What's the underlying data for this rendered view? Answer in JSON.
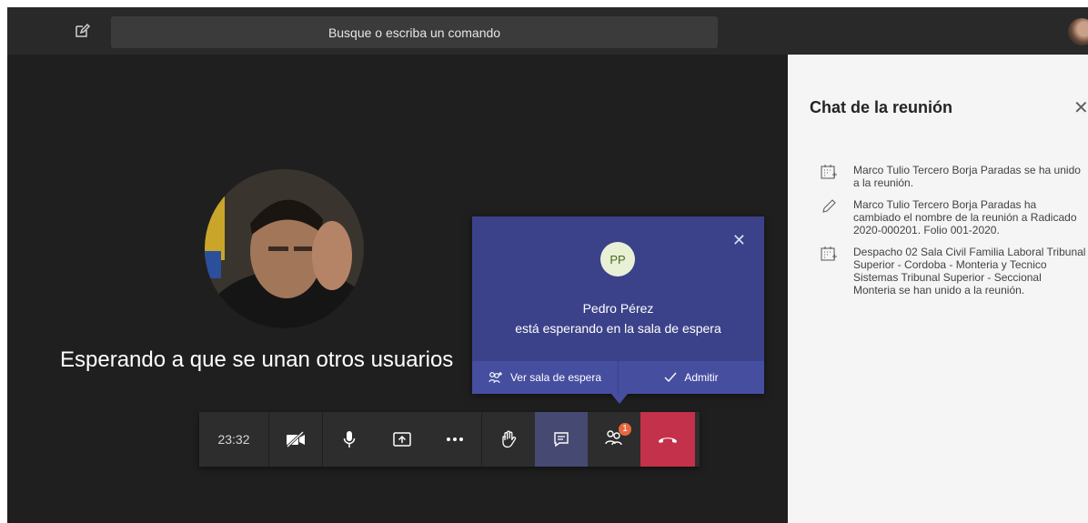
{
  "search": {
    "placeholder": "Busque o escriba un comando"
  },
  "stage": {
    "waiting_text": "Esperando a que se unan otros usuarios"
  },
  "lobby": {
    "initials": "PP",
    "name": "Pedro Pérez",
    "message": "está esperando en la sala de espera",
    "view_lobby_label": "Ver sala de espera",
    "admit_label": "Admitir"
  },
  "callbar": {
    "timer": "23:32",
    "participants_badge": "1"
  },
  "chat": {
    "title": "Chat de la reunión",
    "events": [
      {
        "icon": "join-icon",
        "text": "Marco Tulio Tercero Borja Paradas se ha unido a la reunión."
      },
      {
        "icon": "pencil-icon",
        "text": "Marco Tulio Tercero Borja Paradas ha cambiado el nombre de la reunión a Radicado 2020-000201. Folio 001-2020."
      },
      {
        "icon": "join-icon",
        "text": "Despacho 02 Sala Civil Familia Laboral Tribunal Superior - Cordoba - Monteria y Tecnico Sistemas Tribunal Superior - Seccional Monteria se han unido a la reunión."
      }
    ]
  },
  "colors": {
    "lobby_bg": "#3b4289",
    "hangup": "#c4314b",
    "badge": "#e6683e",
    "active_button": "#464a72"
  }
}
